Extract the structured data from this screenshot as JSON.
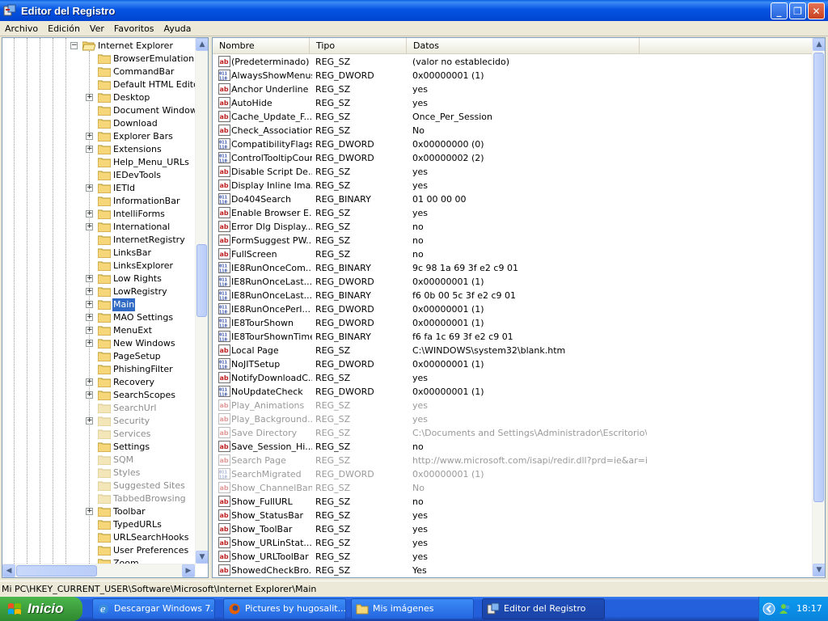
{
  "window": {
    "title": "Editor del Registro",
    "min_glyph": "_",
    "max_glyph": "❐",
    "close_glyph": "✕"
  },
  "menu": [
    "Archivo",
    "Edición",
    "Ver",
    "Favoritos",
    "Ayuda"
  ],
  "tree": {
    "parent": "Internet Explorer",
    "items": [
      {
        "label": "BrowserEmulation",
        "expandable": false,
        "dim": false
      },
      {
        "label": "CommandBar",
        "expandable": false,
        "dim": false
      },
      {
        "label": "Default HTML Editor",
        "expandable": false,
        "dim": false
      },
      {
        "label": "Desktop",
        "expandable": true,
        "dim": false
      },
      {
        "label": "Document Windows",
        "expandable": false,
        "dim": false
      },
      {
        "label": "Download",
        "expandable": false,
        "dim": false
      },
      {
        "label": "Explorer Bars",
        "expandable": true,
        "dim": false
      },
      {
        "label": "Extensions",
        "expandable": true,
        "dim": false
      },
      {
        "label": "Help_Menu_URLs",
        "expandable": false,
        "dim": false
      },
      {
        "label": "IEDevTools",
        "expandable": false,
        "dim": false
      },
      {
        "label": "IETld",
        "expandable": true,
        "dim": false
      },
      {
        "label": "InformationBar",
        "expandable": false,
        "dim": false
      },
      {
        "label": "IntelliForms",
        "expandable": true,
        "dim": false
      },
      {
        "label": "International",
        "expandable": true,
        "dim": false
      },
      {
        "label": "InternetRegistry",
        "expandable": false,
        "dim": false
      },
      {
        "label": "LinksBar",
        "expandable": false,
        "dim": false
      },
      {
        "label": "LinksExplorer",
        "expandable": false,
        "dim": false
      },
      {
        "label": "Low Rights",
        "expandable": true,
        "dim": false
      },
      {
        "label": "LowRegistry",
        "expandable": true,
        "dim": false
      },
      {
        "label": "Main",
        "expandable": true,
        "dim": false,
        "selected": true
      },
      {
        "label": "MAO Settings",
        "expandable": true,
        "dim": false
      },
      {
        "label": "MenuExt",
        "expandable": true,
        "dim": false
      },
      {
        "label": "New Windows",
        "expandable": true,
        "dim": false
      },
      {
        "label": "PageSetup",
        "expandable": false,
        "dim": false
      },
      {
        "label": "PhishingFilter",
        "expandable": false,
        "dim": false
      },
      {
        "label": "Recovery",
        "expandable": true,
        "dim": false
      },
      {
        "label": "SearchScopes",
        "expandable": true,
        "dim": false
      },
      {
        "label": "SearchUrl",
        "expandable": false,
        "dim": true
      },
      {
        "label": "Security",
        "expandable": true,
        "dim": true
      },
      {
        "label": "Services",
        "expandable": false,
        "dim": true
      },
      {
        "label": "Settings",
        "expandable": false,
        "dim": false
      },
      {
        "label": "SQM",
        "expandable": false,
        "dim": true
      },
      {
        "label": "Styles",
        "expandable": false,
        "dim": true
      },
      {
        "label": "Suggested Sites",
        "expandable": false,
        "dim": true
      },
      {
        "label": "TabbedBrowsing",
        "expandable": false,
        "dim": true
      },
      {
        "label": "Toolbar",
        "expandable": true,
        "dim": false
      },
      {
        "label": "TypedURLs",
        "expandable": false,
        "dim": false
      },
      {
        "label": "URLSearchHooks",
        "expandable": false,
        "dim": false
      },
      {
        "label": "User Preferences",
        "expandable": false,
        "dim": false
      },
      {
        "label": "Zoom",
        "expandable": false,
        "dim": false
      }
    ]
  },
  "list": {
    "columns": [
      "Nombre",
      "Tipo",
      "Datos"
    ],
    "rows": [
      {
        "icon": "string",
        "name": "(Predeterminado)",
        "type": "REG_SZ",
        "data": "(valor no establecido)",
        "dim": false
      },
      {
        "icon": "binary",
        "name": "AlwaysShowMenus",
        "type": "REG_DWORD",
        "data": "0x00000001 (1)",
        "dim": false
      },
      {
        "icon": "string",
        "name": "Anchor Underline",
        "type": "REG_SZ",
        "data": "yes",
        "dim": false
      },
      {
        "icon": "string",
        "name": "AutoHide",
        "type": "REG_SZ",
        "data": "yes",
        "dim": false
      },
      {
        "icon": "string",
        "name": "Cache_Update_F...",
        "type": "REG_SZ",
        "data": "Once_Per_Session",
        "dim": false
      },
      {
        "icon": "string",
        "name": "Check_Associations",
        "type": "REG_SZ",
        "data": "No",
        "dim": false
      },
      {
        "icon": "binary",
        "name": "CompatibilityFlags",
        "type": "REG_DWORD",
        "data": "0x00000000 (0)",
        "dim": false
      },
      {
        "icon": "binary",
        "name": "ControlTooltipCount",
        "type": "REG_DWORD",
        "data": "0x00000002 (2)",
        "dim": false
      },
      {
        "icon": "string",
        "name": "Disable Script De...",
        "type": "REG_SZ",
        "data": "yes",
        "dim": false
      },
      {
        "icon": "string",
        "name": "Display Inline Ima...",
        "type": "REG_SZ",
        "data": "yes",
        "dim": false
      },
      {
        "icon": "binary",
        "name": "Do404Search",
        "type": "REG_BINARY",
        "data": "01 00 00 00",
        "dim": false
      },
      {
        "icon": "string",
        "name": "Enable Browser E...",
        "type": "REG_SZ",
        "data": "yes",
        "dim": false
      },
      {
        "icon": "string",
        "name": "Error Dlg Display...",
        "type": "REG_SZ",
        "data": "no",
        "dim": false
      },
      {
        "icon": "string",
        "name": "FormSuggest PW...",
        "type": "REG_SZ",
        "data": "no",
        "dim": false
      },
      {
        "icon": "string",
        "name": "FullScreen",
        "type": "REG_SZ",
        "data": "no",
        "dim": false
      },
      {
        "icon": "binary",
        "name": "IE8RunOnceCom...",
        "type": "REG_BINARY",
        "data": "9c 98 1a 69 3f e2 c9 01",
        "dim": false
      },
      {
        "icon": "binary",
        "name": "IE8RunOnceLast...",
        "type": "REG_DWORD",
        "data": "0x00000001 (1)",
        "dim": false
      },
      {
        "icon": "binary",
        "name": "IE8RunOnceLast...",
        "type": "REG_BINARY",
        "data": "f6 0b 00 5c 3f e2 c9 01",
        "dim": false
      },
      {
        "icon": "binary",
        "name": "IE8RunOncePerI...",
        "type": "REG_DWORD",
        "data": "0x00000001 (1)",
        "dim": false
      },
      {
        "icon": "binary",
        "name": "IE8TourShown",
        "type": "REG_DWORD",
        "data": "0x00000001 (1)",
        "dim": false
      },
      {
        "icon": "binary",
        "name": "IE8TourShownTime",
        "type": "REG_BINARY",
        "data": "f6 fa 1c 69 3f e2 c9 01",
        "dim": false
      },
      {
        "icon": "string",
        "name": "Local Page",
        "type": "REG_SZ",
        "data": "C:\\WINDOWS\\system32\\blank.htm",
        "dim": false
      },
      {
        "icon": "binary",
        "name": "NoJITSetup",
        "type": "REG_DWORD",
        "data": "0x00000001 (1)",
        "dim": false
      },
      {
        "icon": "string",
        "name": "NotifyDownloadC...",
        "type": "REG_SZ",
        "data": "yes",
        "dim": false
      },
      {
        "icon": "binary",
        "name": "NoUpdateCheck",
        "type": "REG_DWORD",
        "data": "0x00000001 (1)",
        "dim": false
      },
      {
        "icon": "string",
        "name": "Play_Animations",
        "type": "REG_SZ",
        "data": "yes",
        "dim": true
      },
      {
        "icon": "string",
        "name": "Play_Background...",
        "type": "REG_SZ",
        "data": "yes",
        "dim": true
      },
      {
        "icon": "string",
        "name": "Save Directory",
        "type": "REG_SZ",
        "data": "C:\\Documents and Settings\\Administrador\\Escritorio\\Al...",
        "dim": true
      },
      {
        "icon": "string",
        "name": "Save_Session_Hi...",
        "type": "REG_SZ",
        "data": "no",
        "dim": false
      },
      {
        "icon": "string",
        "name": "Search Page",
        "type": "REG_SZ",
        "data": "http://www.microsoft.com/isapi/redir.dll?prd=ie&ar=ie...",
        "dim": true
      },
      {
        "icon": "binary",
        "name": "SearchMigrated",
        "type": "REG_DWORD",
        "data": "0x00000001 (1)",
        "dim": true
      },
      {
        "icon": "string",
        "name": "Show_ChannelBand",
        "type": "REG_SZ",
        "data": "No",
        "dim": true
      },
      {
        "icon": "string",
        "name": "Show_FullURL",
        "type": "REG_SZ",
        "data": "no",
        "dim": false
      },
      {
        "icon": "string",
        "name": "Show_StatusBar",
        "type": "REG_SZ",
        "data": "yes",
        "dim": false
      },
      {
        "icon": "string",
        "name": "Show_ToolBar",
        "type": "REG_SZ",
        "data": "yes",
        "dim": false
      },
      {
        "icon": "string",
        "name": "Show_URLinStat...",
        "type": "REG_SZ",
        "data": "yes",
        "dim": false
      },
      {
        "icon": "string",
        "name": "Show_URLToolBar",
        "type": "REG_SZ",
        "data": "yes",
        "dim": false
      },
      {
        "icon": "string",
        "name": "ShowedCheckBro...",
        "type": "REG_SZ",
        "data": "Yes",
        "dim": false
      }
    ]
  },
  "statusbar": "Mi PC\\HKEY_CURRENT_USER\\Software\\Microsoft\\Internet Explorer\\Main",
  "taskbar": {
    "start_label": "Inicio",
    "tasks": [
      {
        "label": "Descargar Windows 7...",
        "icon": "ie-icon",
        "active": false
      },
      {
        "label": "Pictures by hugosalit...",
        "icon": "firefox-icon",
        "active": false
      },
      {
        "label": "Mis imágenes",
        "icon": "folder-icon",
        "active": false
      },
      {
        "label": "Editor del Registro",
        "icon": "regedit-icon",
        "active": true
      }
    ],
    "clock": "18:17"
  }
}
